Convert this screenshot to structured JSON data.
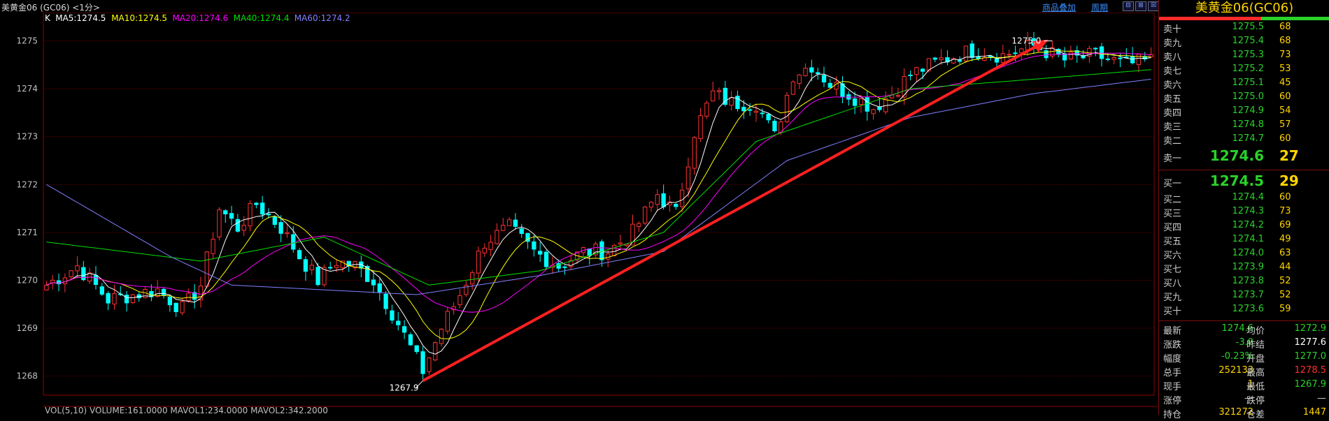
{
  "window": {
    "title": "美黄金06 (GC06) <1分>",
    "links": [
      "商品叠加",
      "周期"
    ],
    "window_buttons": [
      "⊟",
      "⊞",
      "☒"
    ]
  },
  "chart_data": {
    "type": "candlestick",
    "legend": [
      {
        "name": "K",
        "text": "K",
        "color": "#ffffff"
      },
      {
        "name": "MA5",
        "text": "MA5:1274.5",
        "color": "#ffffff"
      },
      {
        "name": "MA10",
        "text": "MA10:1274.5",
        "color": "#ffff00"
      },
      {
        "name": "MA20",
        "text": "MA20:1274.6",
        "color": "#ff00ff"
      },
      {
        "name": "MA40",
        "text": "MA40:1274.4",
        "color": "#00e000"
      },
      {
        "name": "MA60",
        "text": "MA60:1274.2",
        "color": "#8080ff"
      }
    ],
    "ylim": [
      1267.6,
      1275.3
    ],
    "y_ticks": [
      1268,
      1269,
      1270,
      1271,
      1272,
      1273,
      1274,
      1275
    ],
    "num_bars": 180,
    "lowest": {
      "label": "1267.9",
      "bar_index": 61,
      "value": 1267.9
    },
    "highest": {
      "label": "1275.0",
      "bar_index": 163,
      "value": 1275.0
    },
    "close_path": [
      [
        0,
        1269.9
      ],
      [
        5,
        1270.3
      ],
      [
        10,
        1269.6
      ],
      [
        18,
        1269.8
      ],
      [
        22,
        1269.4
      ],
      [
        25,
        1269.9
      ],
      [
        28,
        1271.5
      ],
      [
        31,
        1271.1
      ],
      [
        34,
        1271.6
      ],
      [
        38,
        1271.1
      ],
      [
        41,
        1270.5
      ],
      [
        44,
        1270.0
      ],
      [
        47,
        1270.4
      ],
      [
        50,
        1270.3
      ],
      [
        53,
        1270.0
      ],
      [
        57,
        1269.1
      ],
      [
        61,
        1268.1
      ],
      [
        64,
        1269.0
      ],
      [
        67,
        1269.7
      ],
      [
        71,
        1270.8
      ],
      [
        75,
        1271.1
      ],
      [
        79,
        1270.6
      ],
      [
        83,
        1270.3
      ],
      [
        87,
        1270.6
      ],
      [
        91,
        1270.6
      ],
      [
        95,
        1271.0
      ],
      [
        99,
        1271.8
      ],
      [
        102,
        1271.4
      ],
      [
        105,
        1273.1
      ],
      [
        108,
        1273.9
      ],
      [
        111,
        1273.7
      ],
      [
        115,
        1273.7
      ],
      [
        118,
        1273.0
      ],
      [
        121,
        1274.3
      ],
      [
        124,
        1274.5
      ],
      [
        127,
        1274.1
      ],
      [
        130,
        1273.9
      ],
      [
        134,
        1273.6
      ],
      [
        137,
        1273.9
      ],
      [
        140,
        1274.3
      ],
      [
        145,
        1274.6
      ],
      [
        150,
        1274.8
      ],
      [
        155,
        1274.7
      ],
      [
        160,
        1274.9
      ],
      [
        165,
        1274.6
      ],
      [
        170,
        1274.7
      ],
      [
        175,
        1274.5
      ],
      [
        179,
        1274.6
      ]
    ],
    "trendline": {
      "from": {
        "bar_index": 61,
        "value": 1267.9
      },
      "to": {
        "bar_index": 162,
        "value": 1275.0
      },
      "color": "#ff2020"
    },
    "ma60": [
      [
        0,
        1272.0
      ],
      [
        20,
        1270.5
      ],
      [
        30,
        1269.9
      ],
      [
        60,
        1269.7
      ],
      [
        80,
        1270.1
      ],
      [
        100,
        1270.6
      ],
      [
        120,
        1272.5
      ],
      [
        140,
        1273.4
      ],
      [
        160,
        1273.9
      ],
      [
        179,
        1274.2
      ]
    ],
    "ma40": [
      [
        0,
        1270.8
      ],
      [
        25,
        1270.4
      ],
      [
        45,
        1270.9
      ],
      [
        62,
        1269.9
      ],
      [
        80,
        1270.2
      ],
      [
        100,
        1271.0
      ],
      [
        115,
        1272.9
      ],
      [
        140,
        1274.0
      ],
      [
        160,
        1274.2
      ],
      [
        179,
        1274.4
      ]
    ],
    "volume_bar": "VOL(5,10) VOLUME:161.0000 MAVOL1:234.0000 MAVOL2:342.2000"
  },
  "panel": {
    "title": "美黄金06(GC06)",
    "asks": [
      {
        "label": "卖十",
        "price": "1275.5",
        "vol": "68"
      },
      {
        "label": "卖九",
        "price": "1275.4",
        "vol": "68"
      },
      {
        "label": "卖八",
        "price": "1275.3",
        "vol": "73"
      },
      {
        "label": "卖七",
        "price": "1275.2",
        "vol": "53"
      },
      {
        "label": "卖六",
        "price": "1275.1",
        "vol": "45"
      },
      {
        "label": "卖五",
        "price": "1275.0",
        "vol": "60"
      },
      {
        "label": "卖四",
        "price": "1274.9",
        "vol": "54"
      },
      {
        "label": "卖三",
        "price": "1274.8",
        "vol": "57"
      },
      {
        "label": "卖二",
        "price": "1274.7",
        "vol": "60"
      },
      {
        "label": "卖一",
        "price": "1274.6",
        "vol": "27"
      }
    ],
    "bids": [
      {
        "label": "买一",
        "price": "1274.5",
        "vol": "29"
      },
      {
        "label": "买二",
        "price": "1274.4",
        "vol": "60"
      },
      {
        "label": "买三",
        "price": "1274.3",
        "vol": "73"
      },
      {
        "label": "买四",
        "price": "1274.2",
        "vol": "69"
      },
      {
        "label": "买五",
        "price": "1274.1",
        "vol": "49"
      },
      {
        "label": "买六",
        "price": "1274.0",
        "vol": "63"
      },
      {
        "label": "买七",
        "price": "1273.9",
        "vol": "44"
      },
      {
        "label": "买八",
        "price": "1273.8",
        "vol": "52"
      },
      {
        "label": "买九",
        "price": "1273.7",
        "vol": "52"
      },
      {
        "label": "买十",
        "price": "1273.6",
        "vol": "59"
      }
    ],
    "stats": [
      {
        "l1": "最新",
        "v1": "1274.6",
        "c1": "#2ad22a",
        "l2": "均价",
        "v2": "1272.9",
        "c2": "#2ad22a"
      },
      {
        "l1": "涨跌",
        "v1": "-3.0",
        "c1": "#2ad22a",
        "l2": "昨结",
        "v2": "1277.6",
        "c2": "#ffffff"
      },
      {
        "l1": "幅度",
        "v1": "-0.23%",
        "c1": "#2ad22a",
        "l2": "开盘",
        "v2": "1277.0",
        "c2": "#2ad22a"
      },
      {
        "l1": "总手",
        "v1": "252133",
        "c1": "#ffd400",
        "l2": "最高",
        "v2": "1278.5",
        "c2": "#ff3030"
      },
      {
        "l1": "现手",
        "v1": "1",
        "c1": "#ffd400",
        "l2": "最低",
        "v2": "1267.9",
        "c2": "#2ad22a"
      },
      {
        "l1": "涨停",
        "v1": "—",
        "c1": "#d0d0d0",
        "l2": "跌停",
        "v2": "—",
        "c2": "#d0d0d0"
      },
      {
        "l1": "持仓",
        "v1": "321272",
        "c1": "#ffd400",
        "l2": "仓差",
        "v2": "1447",
        "c2": "#ffd400"
      }
    ]
  }
}
